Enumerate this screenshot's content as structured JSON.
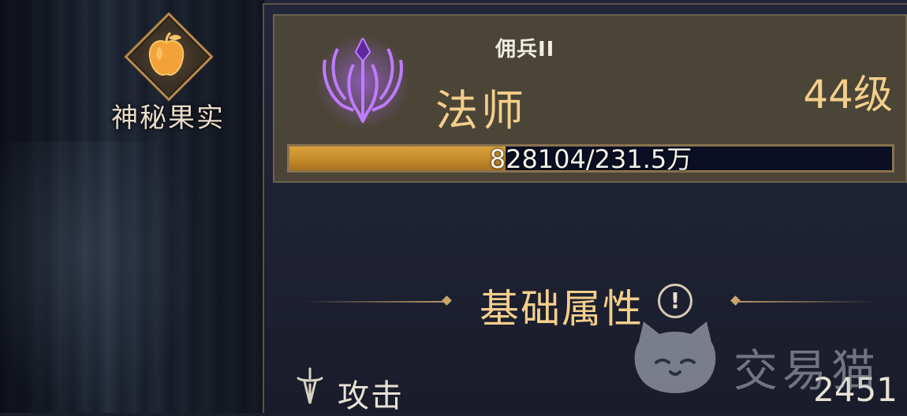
{
  "item": {
    "label": "神秘果实",
    "icon": "apple-icon"
  },
  "header": {
    "rank": "佣兵II",
    "class_name": "法师",
    "level": "44级",
    "class_icon": "mage-crest-icon"
  },
  "xp": {
    "text": "828104/231.5万",
    "current": 828104,
    "max": 2315000,
    "fill_fraction": 0.358
  },
  "section": {
    "title": "基础属性",
    "info_glyph": "!"
  },
  "stats": [
    {
      "label": "攻击",
      "value": "2451",
      "icon": "sword-icon"
    }
  ],
  "watermark": {
    "text": "交易猫",
    "icon": "cat-icon"
  },
  "colors": {
    "gold_text": "#f3cf8b",
    "xp_fill": "#c2882a",
    "xp_track": "#0a0f24",
    "header_bg": "#4b4537",
    "class_icon_purple": "#9b4dff"
  }
}
